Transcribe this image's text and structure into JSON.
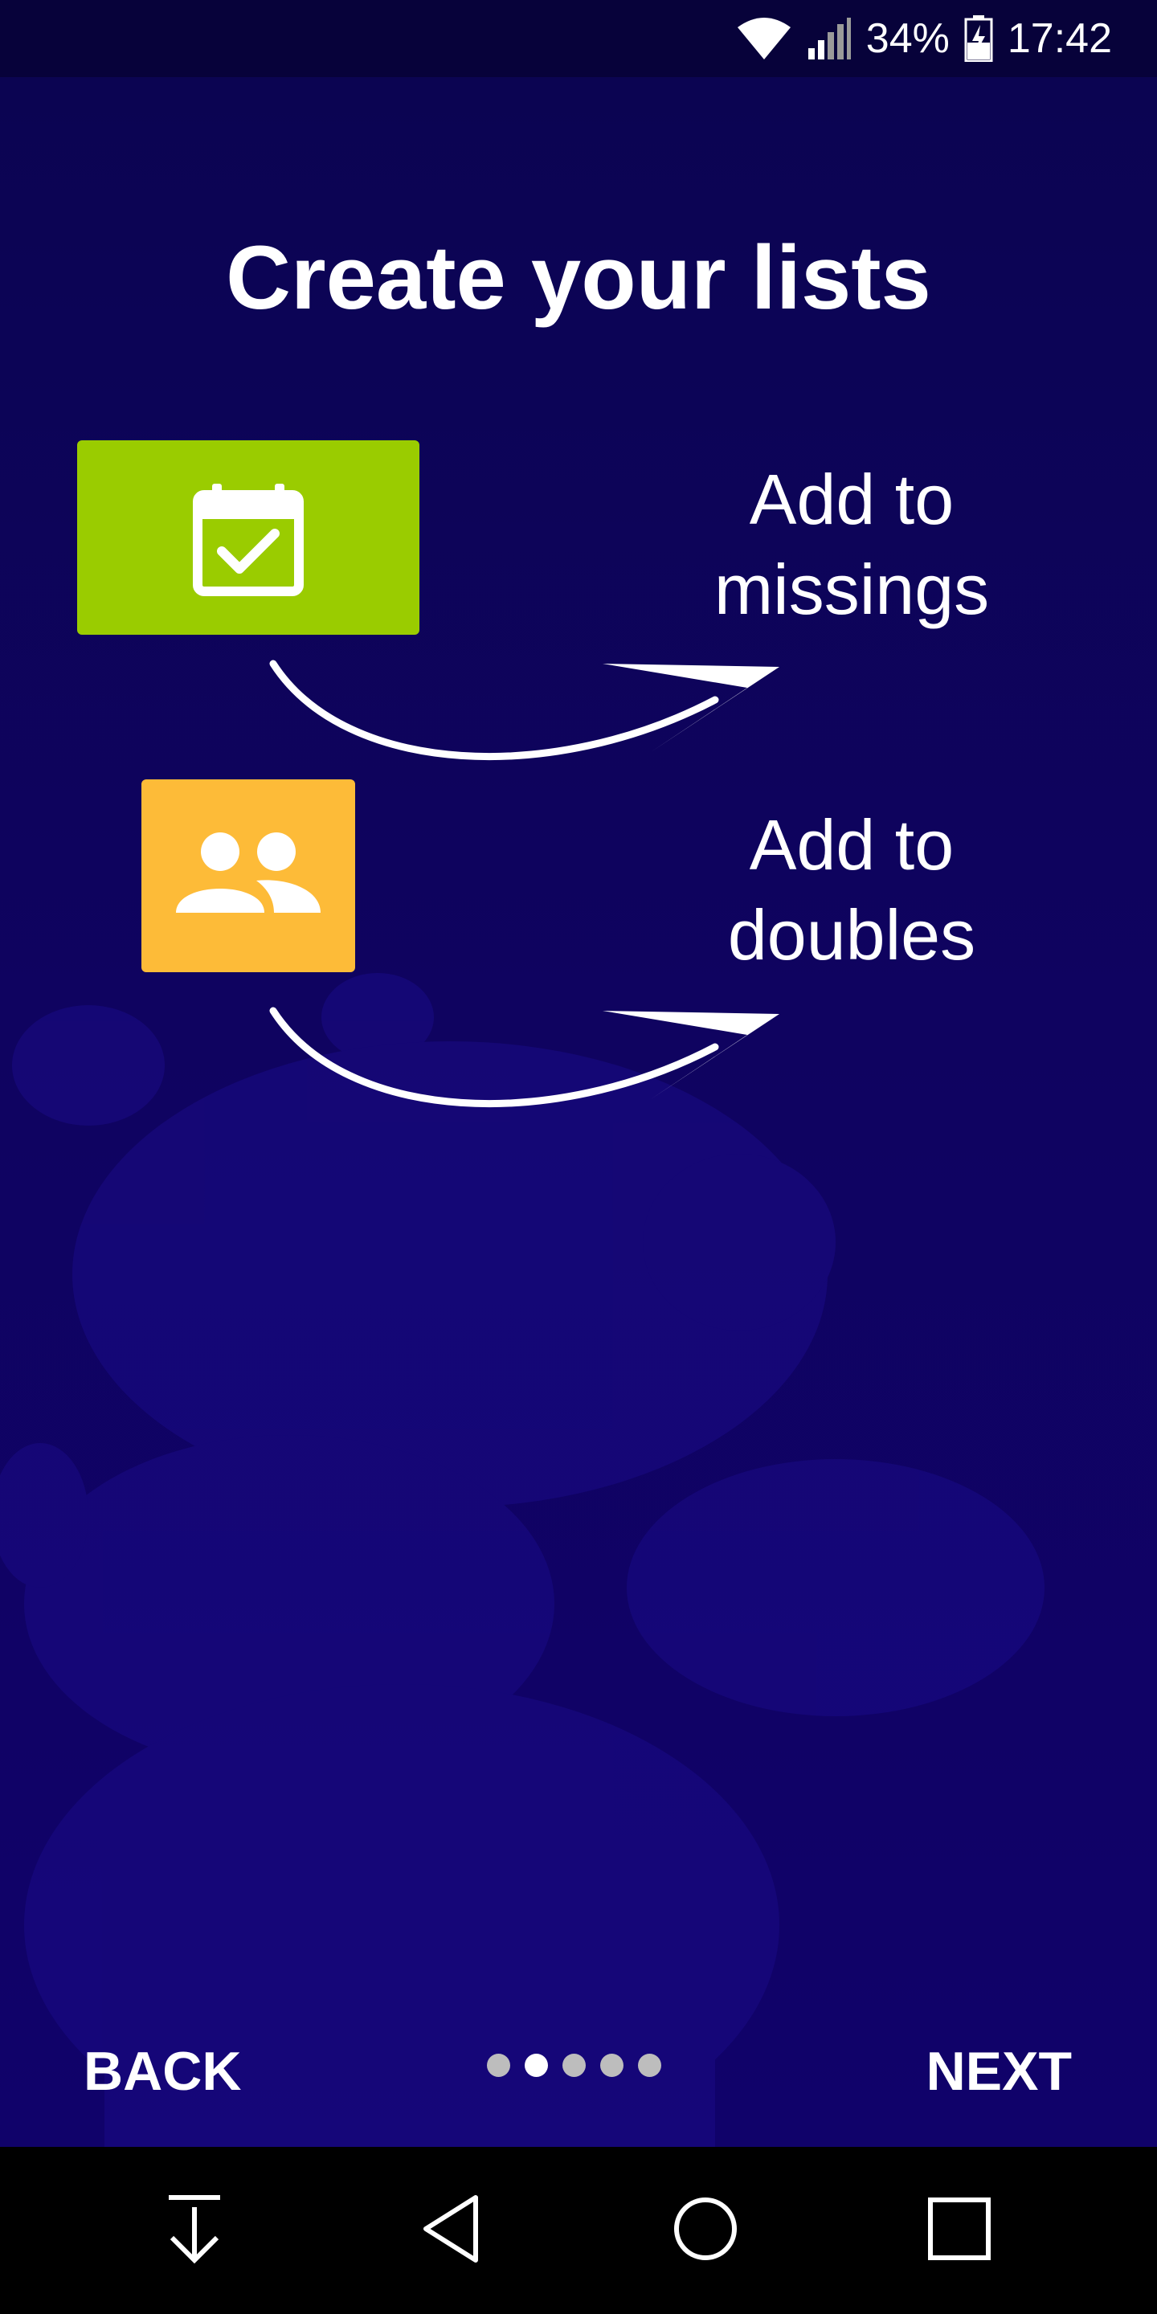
{
  "status_bar": {
    "battery": "34%",
    "time": "17:42",
    "icons": [
      "wifi-icon",
      "signal-icon",
      "battery-charging-icon"
    ]
  },
  "onboarding": {
    "title": "Create your lists",
    "items": [
      {
        "icon": "calendar-check-icon",
        "color": "#9acc00",
        "label_line1": "Add to",
        "label_line2": "missings"
      },
      {
        "icon": "people-icon",
        "color": "#fdbb38",
        "label_line1": "Add to",
        "label_line2": "doubles"
      }
    ],
    "back_label": "BACK",
    "next_label": "NEXT",
    "page_count": 5,
    "current_page": 2
  },
  "system_nav": {
    "buttons": [
      "download-icon",
      "back-icon",
      "home-icon",
      "recents-icon"
    ]
  },
  "colors": {
    "background": "#0b0452",
    "status_bar": "#07023a",
    "mascot_silhouette": "#1a0b86"
  }
}
